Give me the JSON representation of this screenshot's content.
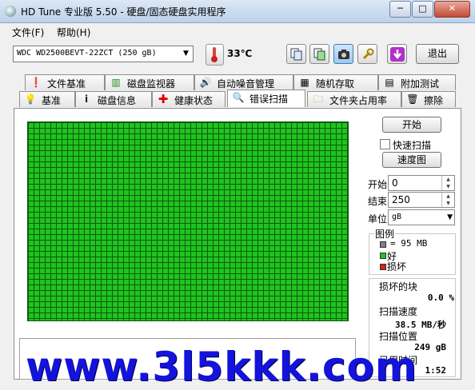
{
  "window": {
    "title": "HD Tune 专业版 5.50 - 硬盘/固态硬盘实用程序",
    "close_label": "✕",
    "min_label": "─",
    "max_label": "□"
  },
  "menu": {
    "file": "文件(F)",
    "help": "帮助(H)"
  },
  "toolbar": {
    "drive": "WDC WD2500BEVT-22ZCT  (250 gB)",
    "temperature": "33℃",
    "exit_label": "退出",
    "icons": [
      "copy-info-icon",
      "copy-screen-icon",
      "screenshot-camera-icon",
      "options-icon",
      "save-down-icon"
    ]
  },
  "tabs_row1": [
    {
      "label": "文件基准",
      "icon": "file-benchmark-icon"
    },
    {
      "label": "磁盘监视器",
      "icon": "disk-monitor-icon"
    },
    {
      "label": "自动噪音管理",
      "icon": "speaker-icon"
    },
    {
      "label": "随机存取",
      "icon": "random-access-icon"
    },
    {
      "label": "附加测试",
      "icon": "extra-tests-icon"
    }
  ],
  "tabs_row2": [
    {
      "label": "基准",
      "icon": "bulb-icon"
    },
    {
      "label": "磁盘信息",
      "icon": "info-icon"
    },
    {
      "label": "健康状态",
      "icon": "health-cross-icon"
    },
    {
      "label": "错误扫描",
      "icon": "magnifier-icon"
    },
    {
      "label": "文件夹占用率",
      "icon": "folder-icon"
    },
    {
      "label": "擦除",
      "icon": "trash-icon"
    }
  ],
  "scan": {
    "start_button": "开始",
    "quick_scan_label": "快速扫描",
    "quick_scan_checked": false,
    "speed_map_button": "速度图",
    "start_label": "开始",
    "start_value": "0",
    "end_label": "结束",
    "end_value": "250",
    "unit_label": "单位",
    "unit_value": "gB",
    "legend_title": "图例",
    "legend_block": "= 95 MB",
    "legend_good": "好",
    "legend_bad": "损坏",
    "damaged_label": "损坏的块",
    "damaged_value": "0.0 %",
    "speed_label": "扫描速度",
    "speed_value": "38.5 MB/秒",
    "position_label": "扫描位置",
    "position_value": "249 gB",
    "elapsed_label": "已用时间",
    "elapsed_value": "1:52"
  },
  "colors": {
    "good": "#1fc41f",
    "bad": "#d42020",
    "block": "#808080"
  },
  "watermark": "www.3l5kkk.com"
}
